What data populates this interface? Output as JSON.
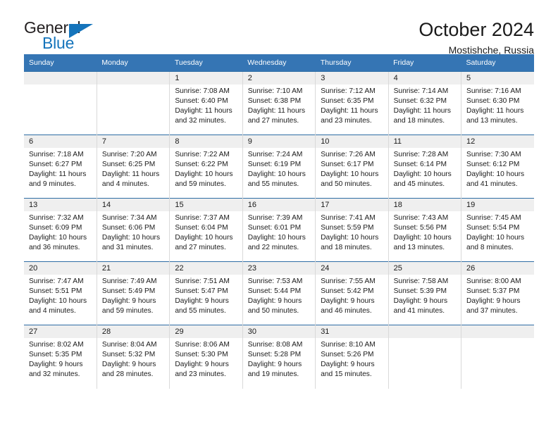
{
  "brand": {
    "name_top": "General",
    "name_bottom": "Blue",
    "triangle_color": "#1574bb",
    "text_color": "#231f20"
  },
  "header": {
    "title": "October 2024",
    "subtitle": "Mostishche, Russia"
  },
  "colors": {
    "header_bg": "#3575b4",
    "row_border": "#2e6da4",
    "daynum_bg": "#efefef",
    "cell_divider": "#d9d9d9"
  },
  "weekday_headers": [
    "Sunday",
    "Monday",
    "Tuesday",
    "Wednesday",
    "Thursday",
    "Friday",
    "Saturday"
  ],
  "weeks": [
    [
      {
        "day": "",
        "lines": []
      },
      {
        "day": "",
        "lines": []
      },
      {
        "day": "1",
        "lines": [
          "Sunrise: 7:08 AM",
          "Sunset: 6:40 PM",
          "Daylight: 11 hours",
          "and 32 minutes."
        ]
      },
      {
        "day": "2",
        "lines": [
          "Sunrise: 7:10 AM",
          "Sunset: 6:38 PM",
          "Daylight: 11 hours",
          "and 27 minutes."
        ]
      },
      {
        "day": "3",
        "lines": [
          "Sunrise: 7:12 AM",
          "Sunset: 6:35 PM",
          "Daylight: 11 hours",
          "and 23 minutes."
        ]
      },
      {
        "day": "4",
        "lines": [
          "Sunrise: 7:14 AM",
          "Sunset: 6:32 PM",
          "Daylight: 11 hours",
          "and 18 minutes."
        ]
      },
      {
        "day": "5",
        "lines": [
          "Sunrise: 7:16 AM",
          "Sunset: 6:30 PM",
          "Daylight: 11 hours",
          "and 13 minutes."
        ]
      }
    ],
    [
      {
        "day": "6",
        "lines": [
          "Sunrise: 7:18 AM",
          "Sunset: 6:27 PM",
          "Daylight: 11 hours",
          "and 9 minutes."
        ]
      },
      {
        "day": "7",
        "lines": [
          "Sunrise: 7:20 AM",
          "Sunset: 6:25 PM",
          "Daylight: 11 hours",
          "and 4 minutes."
        ]
      },
      {
        "day": "8",
        "lines": [
          "Sunrise: 7:22 AM",
          "Sunset: 6:22 PM",
          "Daylight: 10 hours",
          "and 59 minutes."
        ]
      },
      {
        "day": "9",
        "lines": [
          "Sunrise: 7:24 AM",
          "Sunset: 6:19 PM",
          "Daylight: 10 hours",
          "and 55 minutes."
        ]
      },
      {
        "day": "10",
        "lines": [
          "Sunrise: 7:26 AM",
          "Sunset: 6:17 PM",
          "Daylight: 10 hours",
          "and 50 minutes."
        ]
      },
      {
        "day": "11",
        "lines": [
          "Sunrise: 7:28 AM",
          "Sunset: 6:14 PM",
          "Daylight: 10 hours",
          "and 45 minutes."
        ]
      },
      {
        "day": "12",
        "lines": [
          "Sunrise: 7:30 AM",
          "Sunset: 6:12 PM",
          "Daylight: 10 hours",
          "and 41 minutes."
        ]
      }
    ],
    [
      {
        "day": "13",
        "lines": [
          "Sunrise: 7:32 AM",
          "Sunset: 6:09 PM",
          "Daylight: 10 hours",
          "and 36 minutes."
        ]
      },
      {
        "day": "14",
        "lines": [
          "Sunrise: 7:34 AM",
          "Sunset: 6:06 PM",
          "Daylight: 10 hours",
          "and 31 minutes."
        ]
      },
      {
        "day": "15",
        "lines": [
          "Sunrise: 7:37 AM",
          "Sunset: 6:04 PM",
          "Daylight: 10 hours",
          "and 27 minutes."
        ]
      },
      {
        "day": "16",
        "lines": [
          "Sunrise: 7:39 AM",
          "Sunset: 6:01 PM",
          "Daylight: 10 hours",
          "and 22 minutes."
        ]
      },
      {
        "day": "17",
        "lines": [
          "Sunrise: 7:41 AM",
          "Sunset: 5:59 PM",
          "Daylight: 10 hours",
          "and 18 minutes."
        ]
      },
      {
        "day": "18",
        "lines": [
          "Sunrise: 7:43 AM",
          "Sunset: 5:56 PM",
          "Daylight: 10 hours",
          "and 13 minutes."
        ]
      },
      {
        "day": "19",
        "lines": [
          "Sunrise: 7:45 AM",
          "Sunset: 5:54 PM",
          "Daylight: 10 hours",
          "and 8 minutes."
        ]
      }
    ],
    [
      {
        "day": "20",
        "lines": [
          "Sunrise: 7:47 AM",
          "Sunset: 5:51 PM",
          "Daylight: 10 hours",
          "and 4 minutes."
        ]
      },
      {
        "day": "21",
        "lines": [
          "Sunrise: 7:49 AM",
          "Sunset: 5:49 PM",
          "Daylight: 9 hours",
          "and 59 minutes."
        ]
      },
      {
        "day": "22",
        "lines": [
          "Sunrise: 7:51 AM",
          "Sunset: 5:47 PM",
          "Daylight: 9 hours",
          "and 55 minutes."
        ]
      },
      {
        "day": "23",
        "lines": [
          "Sunrise: 7:53 AM",
          "Sunset: 5:44 PM",
          "Daylight: 9 hours",
          "and 50 minutes."
        ]
      },
      {
        "day": "24",
        "lines": [
          "Sunrise: 7:55 AM",
          "Sunset: 5:42 PM",
          "Daylight: 9 hours",
          "and 46 minutes."
        ]
      },
      {
        "day": "25",
        "lines": [
          "Sunrise: 7:58 AM",
          "Sunset: 5:39 PM",
          "Daylight: 9 hours",
          "and 41 minutes."
        ]
      },
      {
        "day": "26",
        "lines": [
          "Sunrise: 8:00 AM",
          "Sunset: 5:37 PM",
          "Daylight: 9 hours",
          "and 37 minutes."
        ]
      }
    ],
    [
      {
        "day": "27",
        "lines": [
          "Sunrise: 8:02 AM",
          "Sunset: 5:35 PM",
          "Daylight: 9 hours",
          "and 32 minutes."
        ]
      },
      {
        "day": "28",
        "lines": [
          "Sunrise: 8:04 AM",
          "Sunset: 5:32 PM",
          "Daylight: 9 hours",
          "and 28 minutes."
        ]
      },
      {
        "day": "29",
        "lines": [
          "Sunrise: 8:06 AM",
          "Sunset: 5:30 PM",
          "Daylight: 9 hours",
          "and 23 minutes."
        ]
      },
      {
        "day": "30",
        "lines": [
          "Sunrise: 8:08 AM",
          "Sunset: 5:28 PM",
          "Daylight: 9 hours",
          "and 19 minutes."
        ]
      },
      {
        "day": "31",
        "lines": [
          "Sunrise: 8:10 AM",
          "Sunset: 5:26 PM",
          "Daylight: 9 hours",
          "and 15 minutes."
        ]
      },
      {
        "day": "",
        "lines": []
      },
      {
        "day": "",
        "lines": []
      }
    ]
  ]
}
